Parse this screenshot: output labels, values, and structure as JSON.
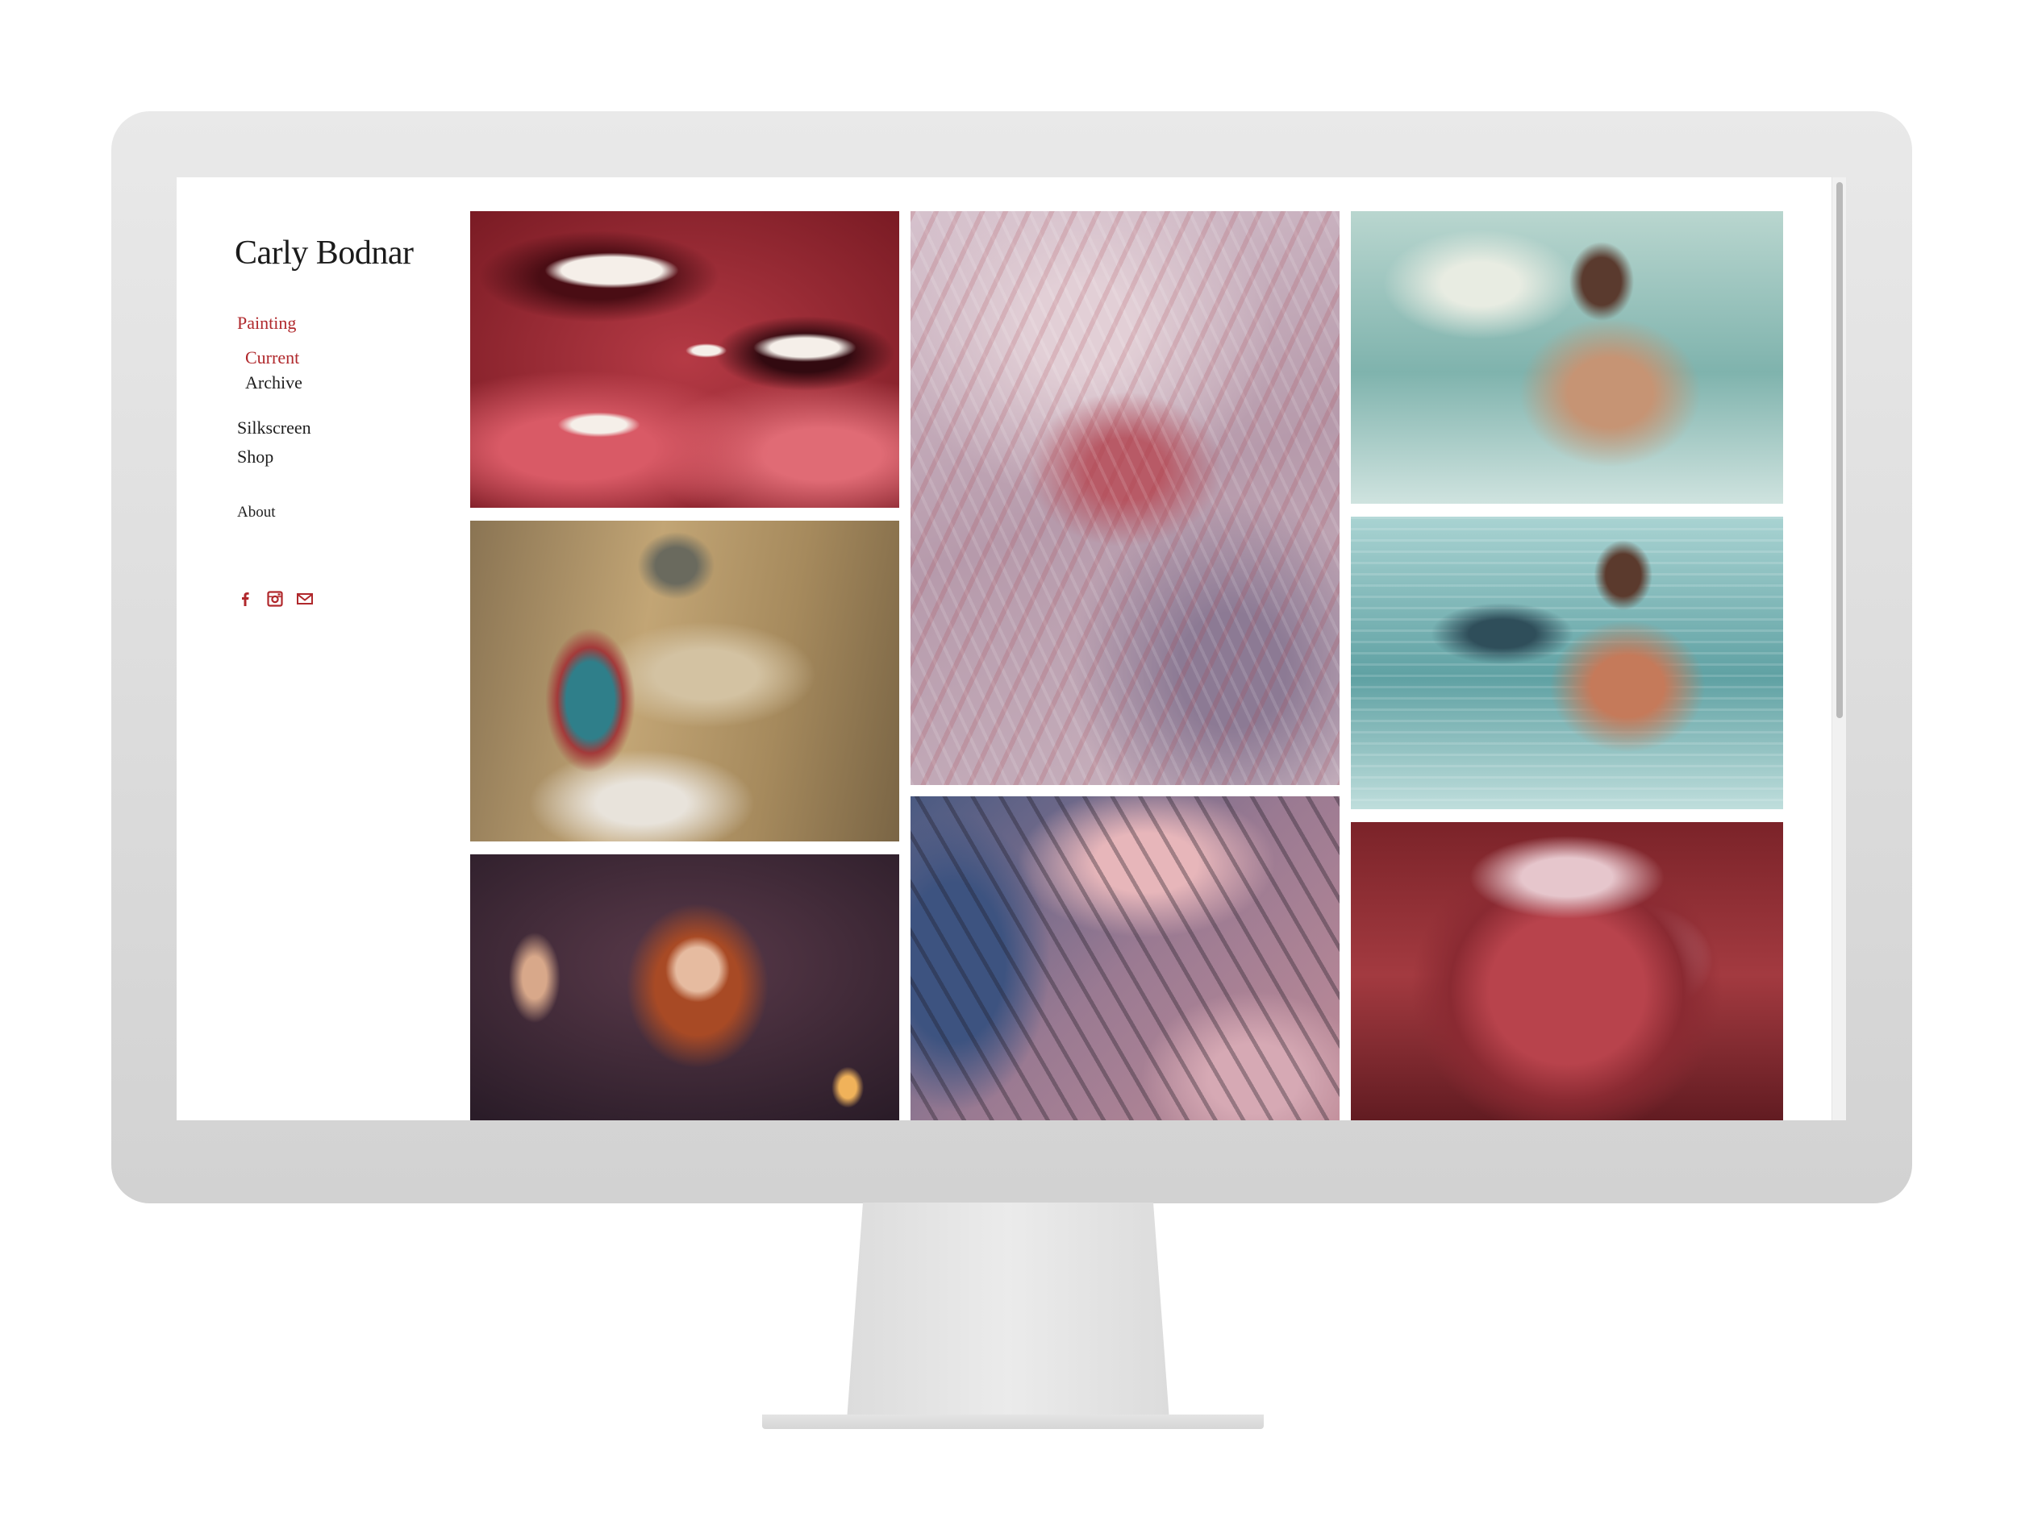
{
  "site": {
    "title": "Carly Bodnar"
  },
  "nav": {
    "painting": "Painting",
    "current": "Current",
    "archive": "Archive",
    "silkscreen": "Silkscreen",
    "shop": "Shop",
    "about": "About"
  },
  "social": {
    "accent_color": "#b0282c",
    "icons": [
      "facebook-icon",
      "instagram-icon",
      "mail-icon"
    ]
  },
  "gallery": {
    "tiles": [
      {
        "id": "lips-and-teeth",
        "dominant_colors": [
          "#c43a47",
          "#7a1a22",
          "#f1e6df"
        ]
      },
      {
        "id": "reclining-tattooed-figure",
        "dominant_colors": [
          "#b59a6b",
          "#5f4e35",
          "#3e8a86"
        ]
      },
      {
        "id": "woman-holding-rat",
        "dominant_colors": [
          "#4b2e3e",
          "#9b4b2b",
          "#e0b08a"
        ]
      },
      {
        "id": "wrinkled-skin-closeup",
        "dominant_colors": [
          "#c9b6c5",
          "#b85a63",
          "#7e6f8b"
        ]
      },
      {
        "id": "skin-folds-closeup",
        "dominant_colors": [
          "#4c5f86",
          "#d59ba3",
          "#2b2531"
        ]
      },
      {
        "id": "woman-in-bathtub",
        "dominant_colors": [
          "#9cc9c2",
          "#3e6b6a",
          "#c79871"
        ]
      },
      {
        "id": "man-in-bathtub-glasses",
        "dominant_colors": [
          "#8fc4c4",
          "#2c6e74",
          "#c3795a"
        ]
      },
      {
        "id": "red-lumpy-sphere",
        "dominant_colors": [
          "#a7383f",
          "#d9a3ad",
          "#5a1a20"
        ]
      }
    ]
  }
}
